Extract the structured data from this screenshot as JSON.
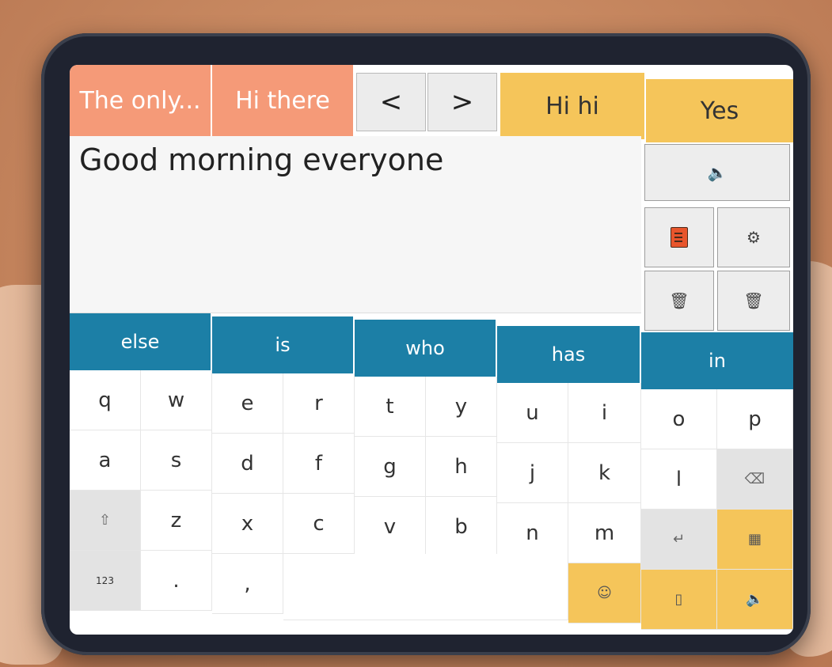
{
  "phrases": [
    "The only...",
    "Hi there"
  ],
  "nav": {
    "prev": "<",
    "next": ">"
  },
  "quick_phrases": [
    "Hi hi",
    "Yes"
  ],
  "text_area": {
    "value": "Good morning everyone"
  },
  "suggestions": [
    "else",
    "is",
    "who",
    "has",
    "in"
  ],
  "keyboard": {
    "row1": [
      "q",
      "w",
      "e",
      "r",
      "t",
      "y",
      "u",
      "i",
      "o",
      "p"
    ],
    "row2": [
      "a",
      "s",
      "d",
      "f",
      "g",
      "h",
      "j",
      "k",
      "l"
    ],
    "row3": [
      "z",
      "x",
      "c",
      "v",
      "b",
      "n",
      "m"
    ],
    "numbers_label": "123",
    "period": ".",
    "comma": ","
  },
  "icons": {
    "speak": "speaker-icon",
    "notes": "notes-icon",
    "settings": "gear-icon",
    "clear": "trash-icon",
    "delete": "trash-icon",
    "backspace": "backspace-icon",
    "shift": "shift-icon",
    "enter": "enter-icon",
    "layout": "grid-icon",
    "emoji": "emoji-icon",
    "device": "device-icon"
  },
  "colors": {
    "phrase": "#f59a78",
    "quick": "#f5c55a",
    "suggestion": "#1c7fa6",
    "notes_icon": "#e8552c"
  }
}
